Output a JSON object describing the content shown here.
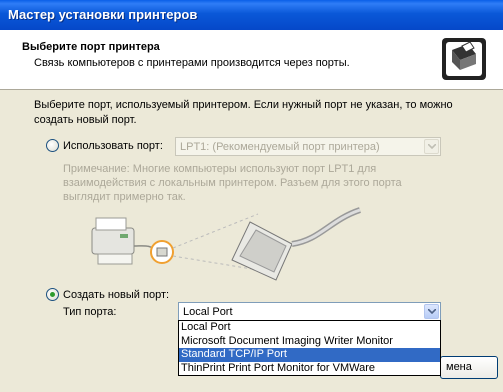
{
  "window": {
    "title": "Мастер установки принтеров"
  },
  "header": {
    "title": "Выберите порт принтера",
    "subtitle": "Связь компьютеров с принтерами производится через порты."
  },
  "instructions": "Выберите порт, используемый принтером. Если нужный порт не указан, то можно создать новый порт.",
  "use_port": {
    "label": "Использовать порт:",
    "selected": false,
    "combo_value": "LPT1: (Рекомендуемый порт принтера)"
  },
  "note": "Примечание: Многие компьютеры используют порт LPT1 для взаимодействия с локальным принтером. Разъем для этого порта выглядит примерно так.",
  "create_port": {
    "label": "Создать новый порт:",
    "selected": true,
    "type_label": "Тип порта:",
    "combo_value": "Local Port"
  },
  "dropdown": {
    "options": [
      "Local Port",
      "Microsoft Document Imaging Writer Monitor",
      "Standard TCP/IP Port",
      "ThinPrint Print Port Monitor for VMWare"
    ],
    "highlighted_index": 2
  },
  "buttons": {
    "cancel_partial": "мена"
  },
  "colors": {
    "highlight": "#316ac5",
    "titlebar": "#0a58d8",
    "radio_dot": "#2e9b2e"
  }
}
